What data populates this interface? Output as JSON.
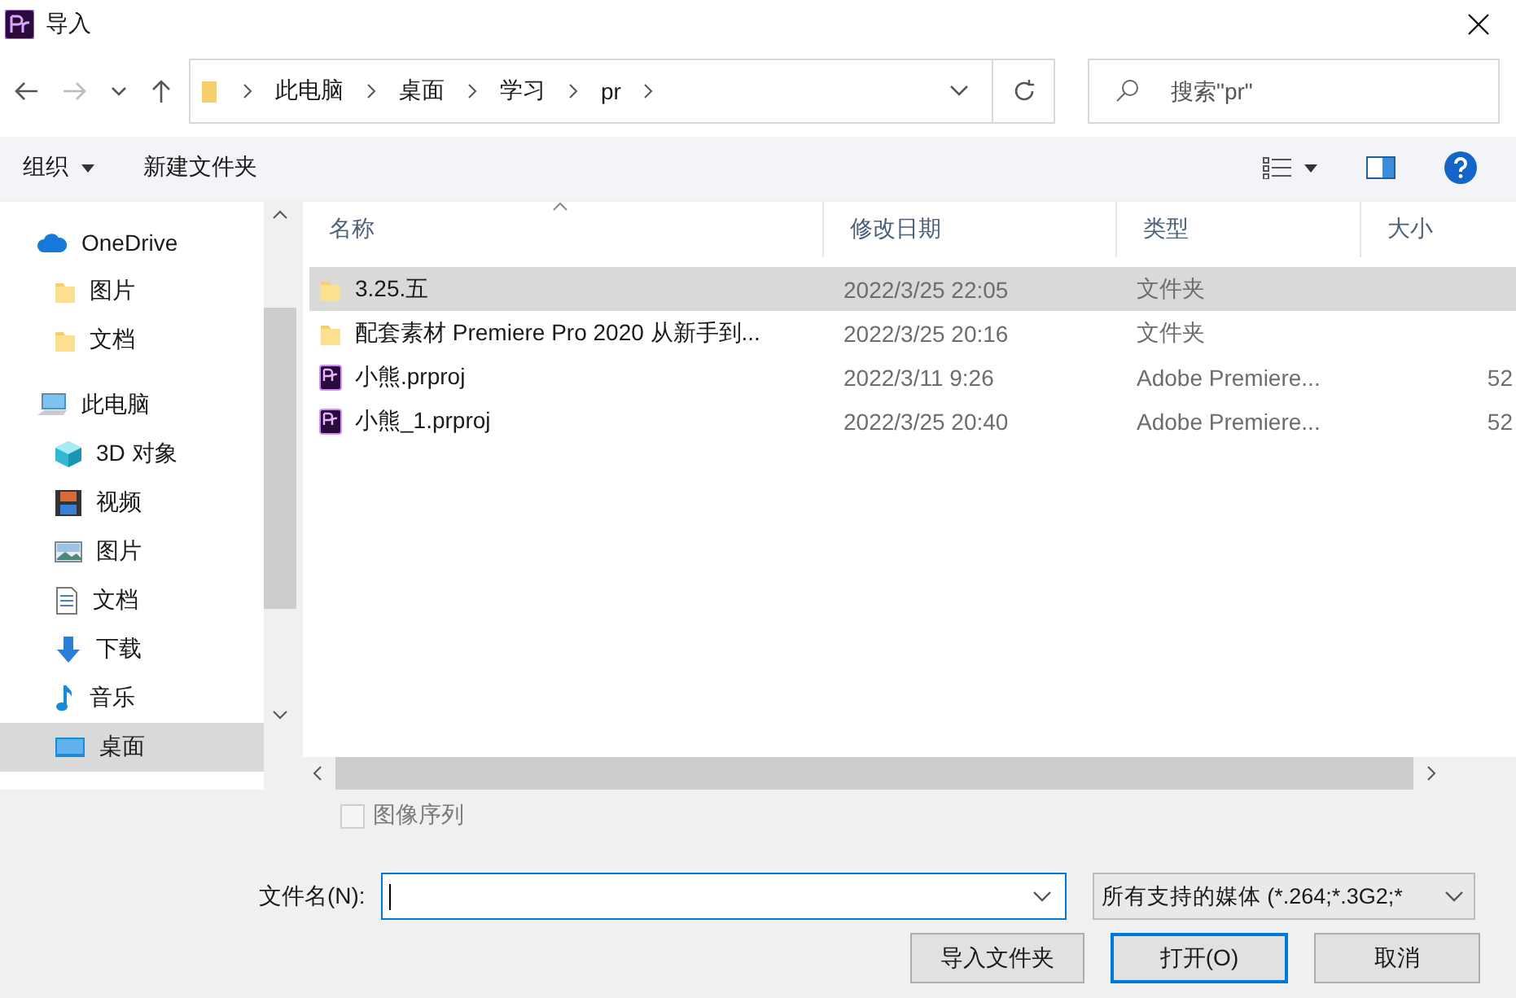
{
  "window": {
    "title": "导入"
  },
  "address": {
    "crumbs": [
      "此电脑",
      "桌面",
      "学习",
      "pr"
    ]
  },
  "search": {
    "placeholder": "搜索\"pr\""
  },
  "toolbar": {
    "organize": "组织",
    "new_folder": "新建文件夹"
  },
  "sidebar": {
    "items": [
      {
        "label": "OneDrive",
        "kind": "cloud",
        "selected": false,
        "children": [
          {
            "label": "图片",
            "kind": "folder",
            "selected": false
          },
          {
            "label": "文档",
            "kind": "folder",
            "selected": false
          }
        ]
      },
      {
        "label": "此电脑",
        "kind": "pc",
        "selected": false,
        "children": [
          {
            "label": "3D 对象",
            "kind": "cube",
            "selected": false
          },
          {
            "label": "视频",
            "kind": "film",
            "selected": false
          },
          {
            "label": "图片",
            "kind": "picture",
            "selected": false
          },
          {
            "label": "文档",
            "kind": "document",
            "selected": false
          },
          {
            "label": "下载",
            "kind": "download",
            "selected": false
          },
          {
            "label": "音乐",
            "kind": "music",
            "selected": false
          },
          {
            "label": "桌面",
            "kind": "desktop",
            "selected": true
          }
        ]
      }
    ]
  },
  "table": {
    "columns": [
      "名称",
      "修改日期",
      "类型",
      "大小"
    ],
    "rows": [
      {
        "name": "3.25.五",
        "kind": "folder",
        "date": "2022/3/25 22:05",
        "type": "文件夹",
        "selected": true
      },
      {
        "name": "配套素材 Premiere Pro 2020 从新手到...",
        "kind": "folder",
        "date": "2022/3/25 20:16",
        "type": "文件夹",
        "selected": false
      },
      {
        "name": "小熊.prproj",
        "kind": "project",
        "date": "2022/3/11 9:26",
        "type": "Adobe Premiere...",
        "size": "52",
        "selected": false
      },
      {
        "name": "小熊_1.prproj",
        "kind": "project",
        "date": "2022/3/25 20:40",
        "type": "Adobe Premiere...",
        "size": "52",
        "selected": false
      }
    ]
  },
  "image_sequence": {
    "label": "图像序列",
    "checked": false,
    "disabled": true
  },
  "filename": {
    "label": "文件名(N):"
  },
  "filter": {
    "value": "所有支持的媒体 (*.264;*.3G2;*"
  },
  "buttons": [
    {
      "label": "导入文件夹",
      "kind": "secondary"
    },
    {
      "label": "打开(O)",
      "kind": "default"
    },
    {
      "label": "取消",
      "kind": "secondary"
    }
  ]
}
